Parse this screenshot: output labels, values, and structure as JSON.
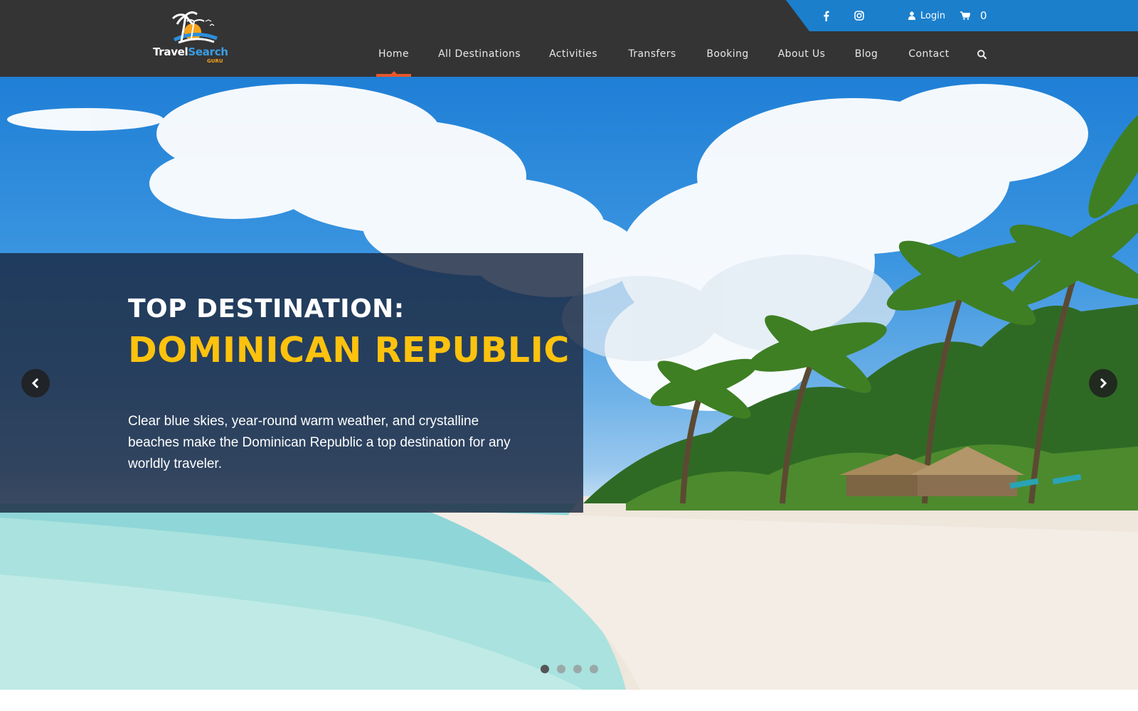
{
  "brand": {
    "name_part1": "Travel",
    "name_part2": "Search",
    "name_sub": "GURU"
  },
  "topbar": {
    "social": [
      {
        "icon": "facebook-icon"
      },
      {
        "icon": "instagram-icon"
      }
    ],
    "login_label": "Login",
    "cart_count": "0"
  },
  "nav": {
    "items": [
      {
        "label": "Home",
        "active": true
      },
      {
        "label": "All Destinations"
      },
      {
        "label": "Activities"
      },
      {
        "label": "Transfers"
      },
      {
        "label": "Booking"
      },
      {
        "label": "About Us"
      },
      {
        "label": "Blog"
      },
      {
        "label": "Contact"
      }
    ],
    "search_icon": "search-icon"
  },
  "hero": {
    "label": "TOP DESTINATION:",
    "title": "DOMINICAN REPUBLIC",
    "description": "Clear blue skies, year-round warm weather, and crystalline beaches make the Dominican Republic a top destination for any worldly traveler.",
    "slide_count": 4,
    "active_slide": 1
  },
  "colors": {
    "header_bg": "#343434",
    "topbar_bg": "#1b7fcc",
    "nav_active": "#e8562a",
    "title_yellow": "#fcc20e",
    "panel_bg": "#1a2740"
  }
}
